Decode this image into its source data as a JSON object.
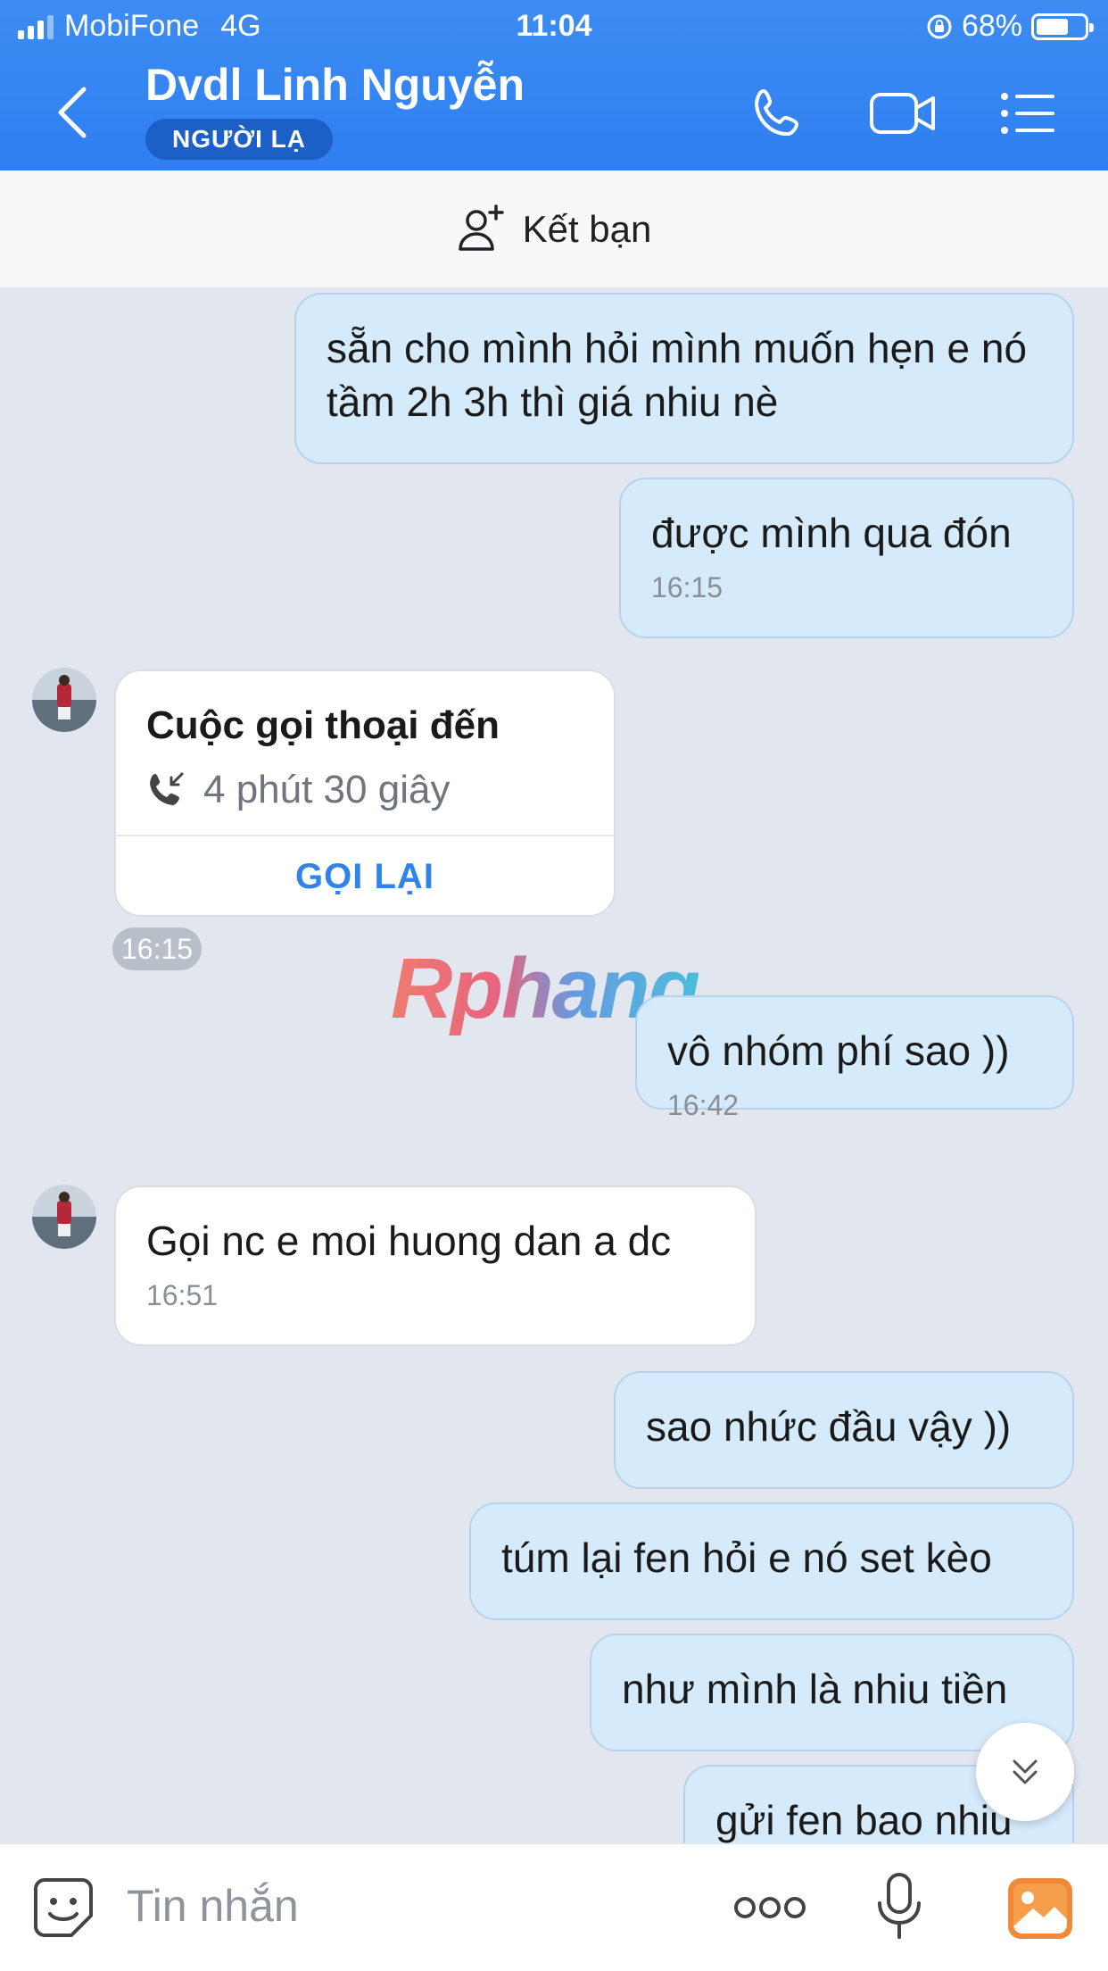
{
  "status_bar": {
    "carrier": "MobiFone",
    "network": "4G",
    "time": "11:04",
    "battery": "68%",
    "battery_level": 0.68
  },
  "header": {
    "title": "Dvdl Linh Nguyễn",
    "badge": "NGƯỜI LẠ"
  },
  "add_friend": {
    "label": "Kết bạn"
  },
  "messages": [
    {
      "dir": "out",
      "text": "sẵn cho mình hỏi mình muốn hẹn e nó tầm 2h 3h thì giá nhiu nè",
      "time": ""
    },
    {
      "dir": "out",
      "text": "được mình qua đón",
      "time": "16:15"
    },
    {
      "dir": "out",
      "text": "vô nhóm phí sao ))",
      "time": "16:42"
    },
    {
      "dir": "in",
      "text": "Gọi nc e moi huong dan a dc",
      "time": "16:51"
    },
    {
      "dir": "out",
      "text": "sao nhức đầu vậy ))",
      "time": ""
    },
    {
      "dir": "out",
      "text": "túm lại fen hỏi e nó set kèo",
      "time": ""
    },
    {
      "dir": "out",
      "text": "như mình là nhiu tiền",
      "time": ""
    },
    {
      "dir": "out",
      "text": "gửi fen bao nhiu",
      "time": ""
    }
  ],
  "call_card": {
    "title": "Cuộc gọi thoại đến",
    "duration": "4 phút 30 giây",
    "action": "GỌI LẠI",
    "time": "16:15"
  },
  "watermark": "Rphang",
  "input": {
    "placeholder": "Tin nhắn"
  },
  "colors": {
    "header": "#2e7ff1",
    "bubble_out": "#d5eafb",
    "bubble_in": "#ffffff",
    "chat_bg": "#e2e6ee",
    "accent": "#2f83ea",
    "gallery": "#f08a3a"
  },
  "icons": [
    "back-chevron-icon",
    "phone-icon",
    "video-camera-icon",
    "menu-list-icon",
    "add-friend-icon",
    "incoming-call-icon",
    "double-chevron-down-icon",
    "sticker-icon",
    "more-dots-icon",
    "microphone-icon",
    "gallery-icon"
  ]
}
